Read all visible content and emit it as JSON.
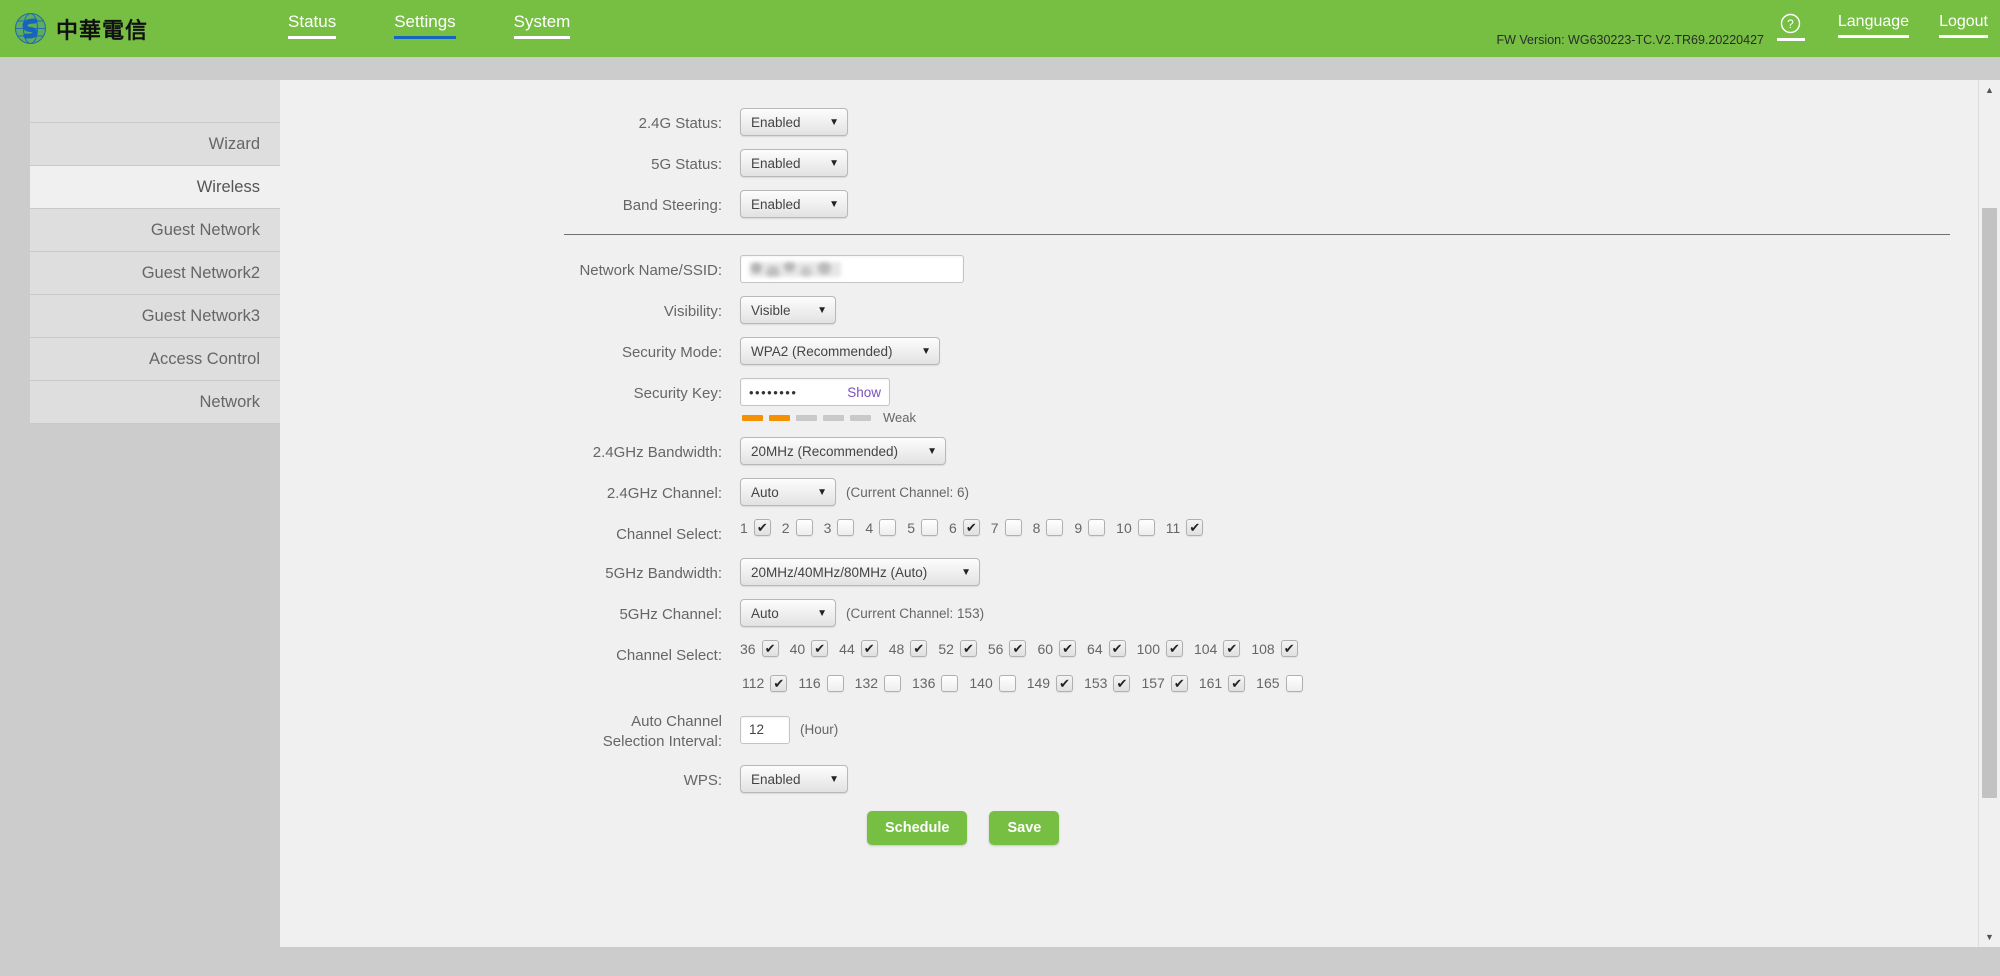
{
  "header": {
    "brand_text": "中華電信",
    "brand_icon": "globe-logo-icon",
    "nav": [
      {
        "label": "Status",
        "active": false
      },
      {
        "label": "Settings",
        "active": true
      },
      {
        "label": "System",
        "active": false
      }
    ],
    "fw_version": "FW Version: WG630223-TC.V2.TR69.20220427",
    "help_icon": "help-circle-icon",
    "language_label": "Language",
    "logout_label": "Logout",
    "bg_color": "#76bf43",
    "active_underline_color": "#1565c0"
  },
  "sidebar": {
    "items": [
      {
        "label": "",
        "active": false
      },
      {
        "label": "Wizard",
        "active": false
      },
      {
        "label": "Wireless",
        "active": true
      },
      {
        "label": "Guest Network",
        "active": false
      },
      {
        "label": "Guest Network2",
        "active": false
      },
      {
        "label": "Guest Network3",
        "active": false
      },
      {
        "label": "Access Control",
        "active": false
      },
      {
        "label": "Network",
        "active": false
      }
    ]
  },
  "form": {
    "status_24g": {
      "label": "2.4G Status:",
      "value": "Enabled"
    },
    "status_5g": {
      "label": "5G Status:",
      "value": "Enabled"
    },
    "band_steering": {
      "label": "Band Steering:",
      "value": "Enabled"
    },
    "ssid": {
      "label": "Network Name/SSID:",
      "value": "",
      "redacted": true
    },
    "visibility": {
      "label": "Visibility:",
      "value": "Visible"
    },
    "security_mode": {
      "label": "Security Mode:",
      "value": "WPA2 (Recommended)"
    },
    "security_key": {
      "label": "Security Key:",
      "value": "••••••••",
      "show_label": "Show",
      "show_link_color": "#7b4fc0"
    },
    "strength": {
      "filled": 2,
      "total": 5,
      "label": "Weak",
      "fill_color": "#f59100",
      "empty_color": "#c9c9c9"
    },
    "bandwidth_24": {
      "label": "2.4GHz Bandwidth:",
      "value": "20MHz (Recommended)"
    },
    "channel_24": {
      "label": "2.4GHz Channel:",
      "value": "Auto",
      "current_text": "(Current Channel: 6)"
    },
    "channel_select_24": {
      "label": "Channel Select:",
      "channels": [
        {
          "num": "1",
          "checked": true
        },
        {
          "num": "2",
          "checked": false
        },
        {
          "num": "3",
          "checked": false
        },
        {
          "num": "4",
          "checked": false
        },
        {
          "num": "5",
          "checked": false
        },
        {
          "num": "6",
          "checked": true
        },
        {
          "num": "7",
          "checked": false
        },
        {
          "num": "8",
          "checked": false
        },
        {
          "num": "9",
          "checked": false
        },
        {
          "num": "10",
          "checked": false
        },
        {
          "num": "11",
          "checked": true
        }
      ]
    },
    "bandwidth_5": {
      "label": "5GHz Bandwidth:",
      "value": "20MHz/40MHz/80MHz (Auto)"
    },
    "channel_5": {
      "label": "5GHz Channel:",
      "value": "Auto",
      "current_text": "(Current Channel: 153)"
    },
    "channel_select_5": {
      "label": "Channel Select:",
      "row1": [
        {
          "num": "36",
          "checked": true
        },
        {
          "num": "40",
          "checked": true
        },
        {
          "num": "44",
          "checked": true
        },
        {
          "num": "48",
          "checked": true
        },
        {
          "num": "52",
          "checked": true
        },
        {
          "num": "56",
          "checked": true
        },
        {
          "num": "60",
          "checked": true
        },
        {
          "num": "64",
          "checked": true
        },
        {
          "num": "100",
          "checked": true
        },
        {
          "num": "104",
          "checked": true
        },
        {
          "num": "108",
          "checked": true
        }
      ],
      "row2": [
        {
          "num": "112",
          "checked": true
        },
        {
          "num": "116",
          "checked": false
        },
        {
          "num": "132",
          "checked": false
        },
        {
          "num": "136",
          "checked": false
        },
        {
          "num": "140",
          "checked": false
        },
        {
          "num": "149",
          "checked": true
        },
        {
          "num": "153",
          "checked": true
        },
        {
          "num": "157",
          "checked": true
        },
        {
          "num": "161",
          "checked": true
        },
        {
          "num": "165",
          "checked": false
        }
      ]
    },
    "auto_channel_interval": {
      "label_line1": "Auto Channel",
      "label_line2": "Selection Interval:",
      "value": "12",
      "unit": "(Hour)"
    },
    "wps": {
      "label": "WPS:",
      "value": "Enabled"
    },
    "buttons": {
      "schedule": "Schedule",
      "save": "Save",
      "color": "#76bf43"
    }
  },
  "icons": {
    "caret_down": "▼",
    "check": "✔",
    "scroll_up": "▲",
    "scroll_down": "▼"
  }
}
